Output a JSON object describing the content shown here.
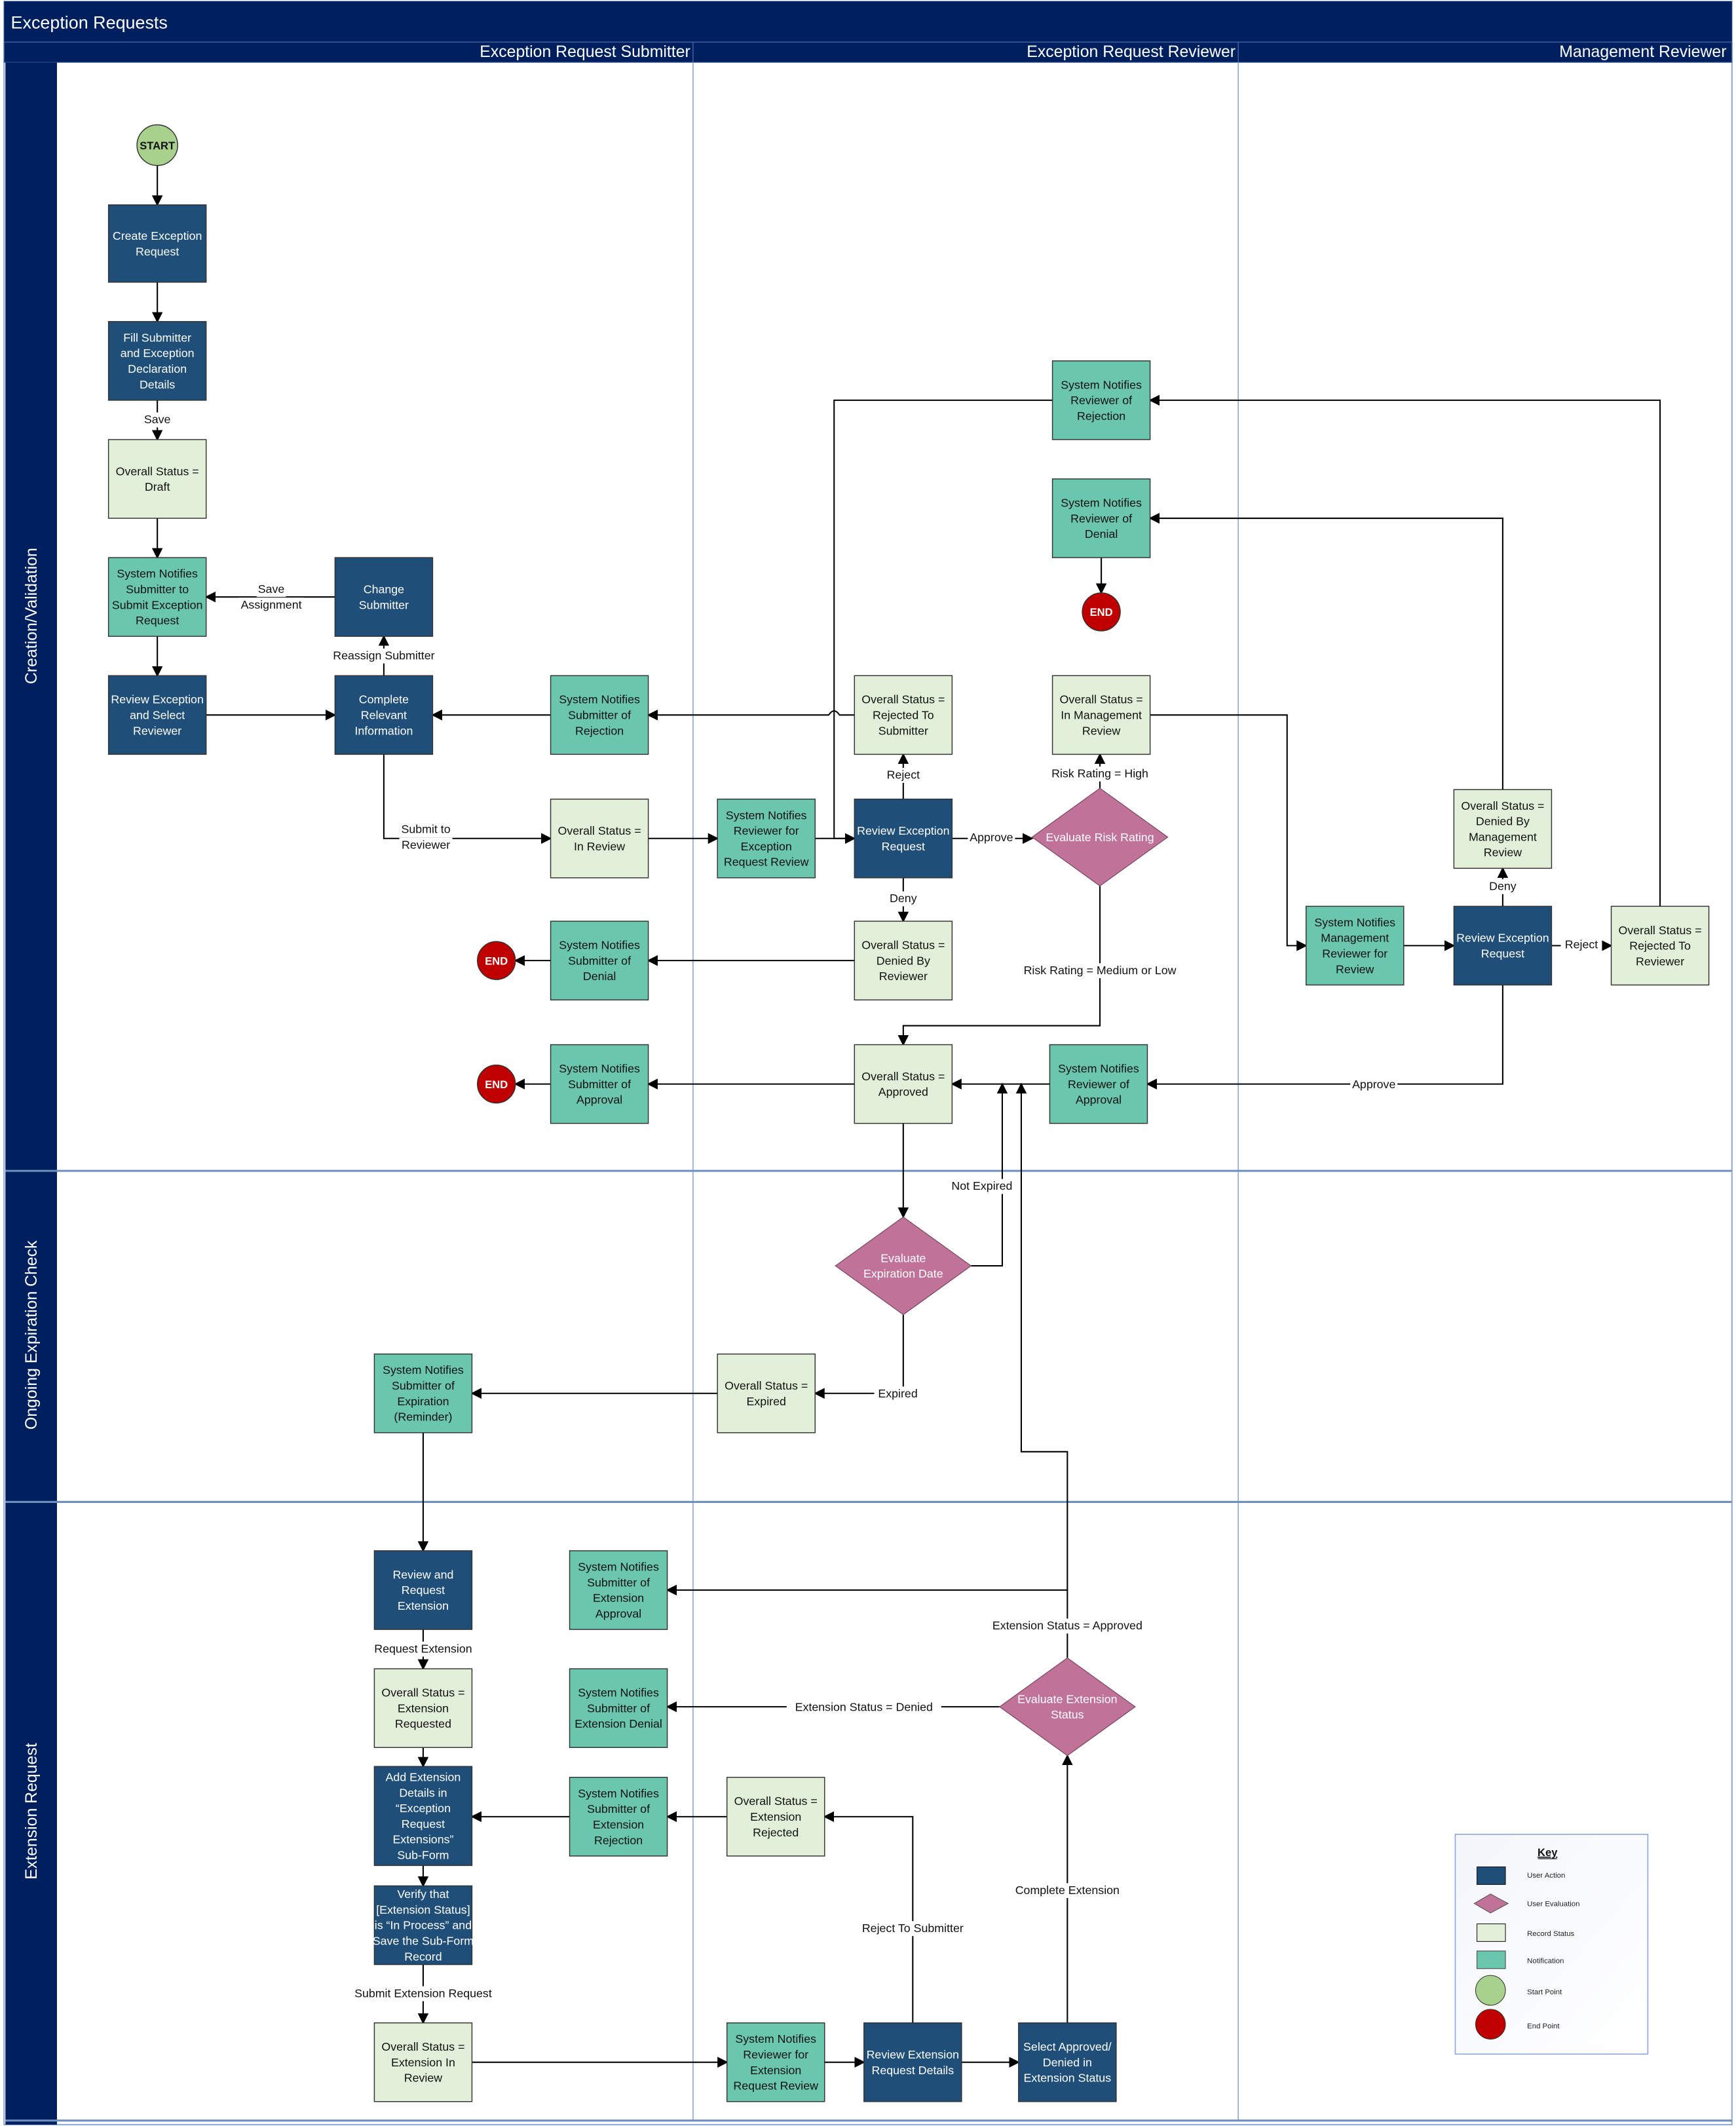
{
  "title": "Exception Requests",
  "colors": {
    "header_bg": "#001F5F",
    "user_action": "#1F4E79",
    "user_evaluation": "#C07298",
    "record_status": "#E2EFD9",
    "notification": "#6AC6AC",
    "start_point": "#A9D18E",
    "end_point": "#C00000",
    "lane_divider": "#8EA9DB"
  },
  "lanes": [
    {
      "id": "submitter",
      "label": "Exception Request Submitter"
    },
    {
      "id": "reviewer",
      "label": "Exception Request Reviewer"
    },
    {
      "id": "management",
      "label": "Management Reviewer"
    }
  ],
  "phases": [
    {
      "id": "creation",
      "label": "Creation/Validation"
    },
    {
      "id": "expiration",
      "label": "Ongoing Expiration Check"
    },
    {
      "id": "extension",
      "label": "Extension Request"
    }
  ],
  "nodes": [
    {
      "id": "start",
      "type": "start",
      "lines": [
        "START"
      ]
    },
    {
      "id": "create",
      "type": "action",
      "lines": [
        "Create Exception",
        "Request"
      ]
    },
    {
      "id": "fill",
      "type": "action",
      "lines": [
        "Fill Submitter",
        "and Exception",
        "Declaration",
        "Details"
      ]
    },
    {
      "id": "draft",
      "type": "status",
      "lines": [
        "Overall Status =",
        "Draft"
      ]
    },
    {
      "id": "sn_submit",
      "type": "notification",
      "lines": [
        "System Notifies",
        "Submitter to",
        "Submit Exception",
        "Request"
      ]
    },
    {
      "id": "review_select",
      "type": "action",
      "lines": [
        "Review Exception",
        "and Select",
        "Reviewer"
      ]
    },
    {
      "id": "change_submitter",
      "type": "action",
      "lines": [
        "Change",
        "Submitter"
      ]
    },
    {
      "id": "complete_info",
      "type": "action",
      "lines": [
        "Complete",
        "Relevant",
        "Information"
      ]
    },
    {
      "id": "sn_sub_rejection",
      "type": "notification",
      "lines": [
        "System Notifies",
        "Submitter of",
        "Rejection"
      ]
    },
    {
      "id": "in_review",
      "type": "status",
      "lines": [
        "Overall Status =",
        "In Review"
      ]
    },
    {
      "id": "sn_sub_denial",
      "type": "notification",
      "lines": [
        "System Notifies",
        "Submitter of",
        "Denial"
      ]
    },
    {
      "id": "end_denial",
      "type": "end",
      "lines": [
        "END"
      ]
    },
    {
      "id": "sn_sub_approval",
      "type": "notification",
      "lines": [
        "System Notifies",
        "Submitter of",
        "Approval"
      ]
    },
    {
      "id": "end_approval",
      "type": "end",
      "lines": [
        "END"
      ]
    },
    {
      "id": "sn_rev_review",
      "type": "notification",
      "lines": [
        "System Notifies",
        "Reviewer for",
        "Exception",
        "Request Review"
      ]
    },
    {
      "id": "review_request",
      "type": "action",
      "lines": [
        "Review Exception",
        "Request"
      ]
    },
    {
      "id": "rejected_to_submitter",
      "type": "status",
      "lines": [
        "Overall Status =",
        "Rejected To",
        "Submitter"
      ]
    },
    {
      "id": "denied_by_reviewer",
      "type": "status",
      "lines": [
        "Overall Status =",
        "Denied By",
        "Reviewer"
      ]
    },
    {
      "id": "approved",
      "type": "status",
      "lines": [
        "Overall Status =",
        "Approved"
      ]
    },
    {
      "id": "eval_risk",
      "type": "decision",
      "lines": [
        "Evaluate Risk Rating"
      ]
    },
    {
      "id": "in_mgmt_review",
      "type": "status",
      "lines": [
        "Overall Status =",
        "In Management",
        "Review"
      ]
    },
    {
      "id": "sn_rev_rejection",
      "type": "notification",
      "lines": [
        "System Notifies",
        "Reviewer of",
        "Rejection"
      ]
    },
    {
      "id": "sn_rev_denial",
      "type": "notification",
      "lines": [
        "System Notifies",
        "Reviewer of",
        "Denial"
      ]
    },
    {
      "id": "end_rev_denial",
      "type": "end",
      "lines": [
        "END"
      ]
    },
    {
      "id": "sn_rev_approval",
      "type": "notification",
      "lines": [
        "System Notifies",
        "Reviewer of",
        "Approval"
      ]
    },
    {
      "id": "sn_mgmt_review",
      "type": "notification",
      "lines": [
        "System Notifies",
        "Management",
        "Reviewer for",
        "Review"
      ]
    },
    {
      "id": "mgmt_review_request",
      "type": "action",
      "lines": [
        "Review Exception",
        "Request"
      ]
    },
    {
      "id": "denied_by_mgmt",
      "type": "status",
      "lines": [
        "Overall Status =",
        "Denied By",
        "Management",
        "Review"
      ]
    },
    {
      "id": "rejected_to_reviewer",
      "type": "status",
      "lines": [
        "Overall Status =",
        "Rejected To",
        "Reviewer"
      ]
    },
    {
      "id": "eval_expiration",
      "type": "decision",
      "lines": [
        "Evaluate",
        "Expiration Date"
      ]
    },
    {
      "id": "expired",
      "type": "status",
      "lines": [
        "Overall Status =",
        "Expired"
      ]
    },
    {
      "id": "sn_expiration",
      "type": "notification",
      "lines": [
        "System Notifies",
        "Submitter of",
        "Expiration",
        "(Reminder)"
      ]
    },
    {
      "id": "review_request_ext",
      "type": "action",
      "lines": [
        "Review and",
        "Request",
        "Extension"
      ]
    },
    {
      "id": "ext_requested",
      "type": "status",
      "lines": [
        "Overall Status =",
        "Extension",
        "Requested"
      ]
    },
    {
      "id": "add_ext_details",
      "type": "action",
      "lines": [
        "Add Extension",
        "Details in",
        "“Exception",
        "Request",
        "Extensions”",
        "Sub-Form"
      ]
    },
    {
      "id": "verify",
      "type": "action",
      "lines": [
        "Verify that",
        "[Extension Status]",
        "is “In Process” and",
        "Save the Sub-Form",
        "Record"
      ]
    },
    {
      "id": "ext_in_review",
      "type": "status",
      "lines": [
        "Overall Status =",
        "Extension In",
        "Review"
      ]
    },
    {
      "id": "sn_ext_approval",
      "type": "notification",
      "lines": [
        "System Notifies",
        "Submitter of",
        "Extension",
        "Approval"
      ]
    },
    {
      "id": "sn_ext_denial",
      "type": "notification",
      "lines": [
        "System Notifies",
        "Submitter of",
        "Extension Denial"
      ]
    },
    {
      "id": "sn_ext_rejection",
      "type": "notification",
      "lines": [
        "System Notifies",
        "Submitter of",
        "Extension",
        "Rejection"
      ]
    },
    {
      "id": "ext_rejected",
      "type": "status",
      "lines": [
        "Overall Status =",
        "Extension",
        "Rejected"
      ]
    },
    {
      "id": "sn_rev_ext_review",
      "type": "notification",
      "lines": [
        "System Notifies",
        "Reviewer for",
        "Extension",
        "Request Review"
      ]
    },
    {
      "id": "review_ext_details",
      "type": "action",
      "lines": [
        "Review Extension",
        "Request Details"
      ]
    },
    {
      "id": "select_ext_status",
      "type": "action",
      "lines": [
        "Select Approved/",
        "Denied in",
        "Extension Status"
      ]
    },
    {
      "id": "eval_ext_status",
      "type": "decision",
      "lines": [
        "Evaluate Extension",
        "Status"
      ]
    }
  ],
  "edge_labels": {
    "save": [
      "Save"
    ],
    "save_assignment": [
      "Save",
      "Assignment"
    ],
    "reassign_submitter": [
      "Reassign Submitter"
    ],
    "submit_to_reviewer": [
      "Submit to",
      "Reviewer"
    ],
    "reject": [
      "Reject"
    ],
    "deny": [
      "Deny"
    ],
    "approve": [
      "Approve"
    ],
    "risk_high": [
      "Risk Rating = High"
    ],
    "risk_medium_low": [
      "Risk Rating = Medium or Low"
    ],
    "mgmt_deny": [
      "Deny"
    ],
    "mgmt_reject": [
      "Reject"
    ],
    "mgmt_approve": [
      "Approve"
    ],
    "not_expired": [
      "Not Expired"
    ],
    "expired": [
      "Expired"
    ],
    "request_extension": [
      "Request Extension"
    ],
    "submit_extension_request": [
      "Submit Extension Request"
    ],
    "ext_approved": [
      "Extension Status = Approved"
    ],
    "ext_denied": [
      "Extension Status = Denied"
    ],
    "reject_to_submitter": [
      "Reject To Submitter"
    ],
    "complete_extension": [
      "Complete Extension"
    ]
  },
  "key": {
    "title": "Key",
    "items": [
      {
        "type": "action",
        "label": "User Action"
      },
      {
        "type": "decision",
        "label": "User Evaluation"
      },
      {
        "type": "status",
        "label": "Record Status"
      },
      {
        "type": "notification",
        "label": "Notification"
      },
      {
        "type": "start",
        "label": "Start Point"
      },
      {
        "type": "end",
        "label": "End Point"
      }
    ]
  }
}
